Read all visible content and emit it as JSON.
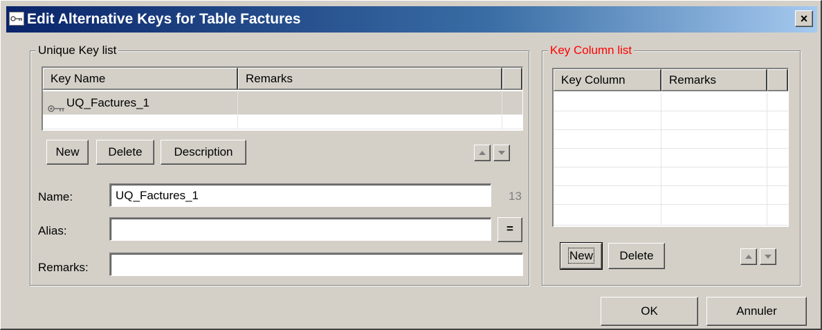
{
  "window": {
    "title": "Edit Alternative Keys for Table Factures",
    "close_glyph": "×"
  },
  "unique_keys": {
    "legend": "Unique Key list",
    "columns": [
      "Key Name",
      "Remarks"
    ],
    "rows": [
      {
        "name": "UQ_Factures_1",
        "remarks": "",
        "icon": "key-icon",
        "selected": true
      }
    ],
    "buttons": {
      "new": "New",
      "delete": "Delete",
      "description": "Description"
    }
  },
  "form": {
    "name_label": "Name:",
    "name_value": "UQ_Factures_1",
    "name_count": "13",
    "alias_label": "Alias:",
    "alias_value": "",
    "alias_button": "=",
    "remarks_label": "Remarks:",
    "remarks_value": ""
  },
  "key_columns": {
    "legend": "Key Column list",
    "legend_color": "#ff0000",
    "columns": [
      "Key Column",
      "Remarks"
    ],
    "rows": [],
    "buttons": {
      "new": "New",
      "delete": "Delete"
    }
  },
  "dialog_buttons": {
    "ok": "OK",
    "cancel": "Annuler"
  }
}
